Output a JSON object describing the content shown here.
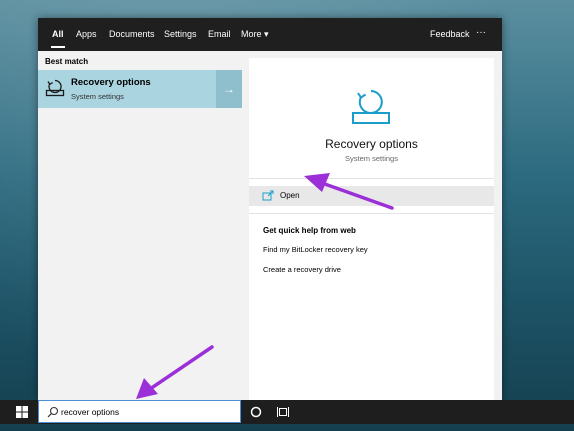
{
  "search_nav": {
    "tabs": [
      {
        "label": "All"
      },
      {
        "label": "Apps"
      },
      {
        "label": "Documents"
      },
      {
        "label": "Settings"
      },
      {
        "label": "Email"
      },
      {
        "label": "More ▾"
      }
    ],
    "feedback_label": "Feedback",
    "more_options_label": "···"
  },
  "results": {
    "section_label": "Best match",
    "best_match": {
      "title": "Recovery options",
      "subtitle": "System settings",
      "icon": "recovery-icon",
      "arrow": "→"
    }
  },
  "details": {
    "title": "Recovery options",
    "subtitle": "System settings",
    "icon": "recovery-icon",
    "open_label": "Open",
    "web_heading": "Get quick help from web",
    "web_links": [
      "Find my BitLocker recovery key",
      "Create a recovery drive"
    ]
  },
  "taskbar": {
    "search_value": "recover options",
    "start_icon": "windows-logo-icon",
    "cortana_icon": "cortana-circle-icon",
    "task_view_icon": "task-view-icon"
  },
  "colors": {
    "selected_result": "#a9d4e0",
    "accent": "#1a9ec9",
    "annotation_arrow": "#9b30d9"
  }
}
